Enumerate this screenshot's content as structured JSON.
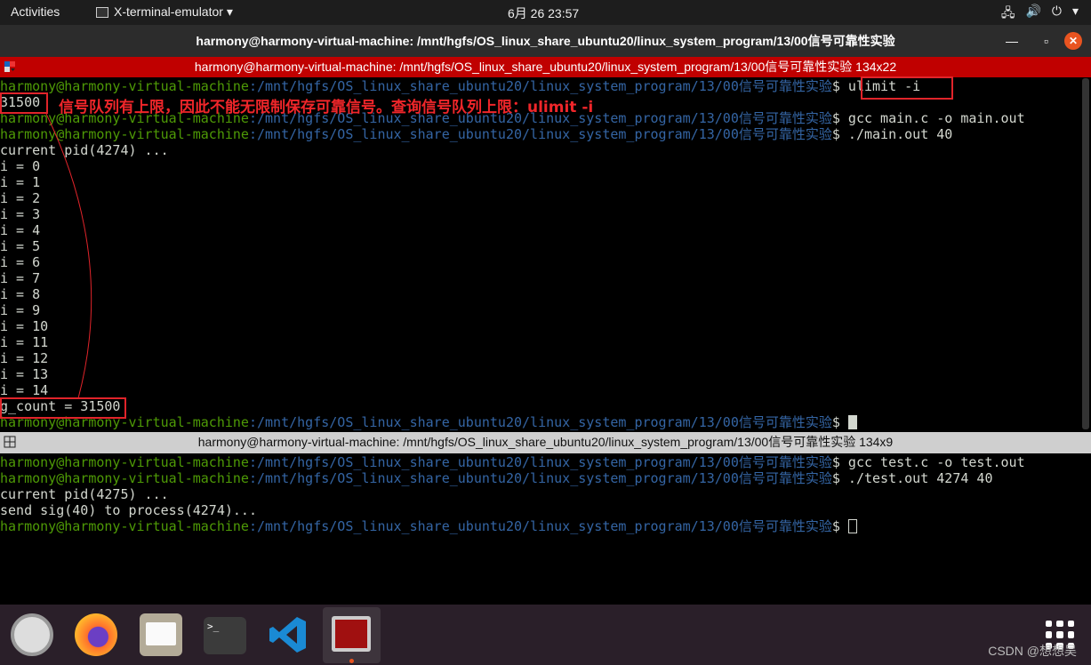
{
  "topbar": {
    "activities": "Activities",
    "app_name": "X-terminal-emulator ▾",
    "clock": "6月 26  23:57",
    "tray": [
      "network-icon",
      "volume-icon",
      "power-icon"
    ],
    "tray_glyphs": [
      "🖧",
      "🔊",
      "⏻",
      "▾"
    ]
  },
  "window": {
    "title": "harmony@harmony-virtual-machine: /mnt/hgfs/OS_linux_share_ubuntu20/linux_system_program/13/00信号可靠性实验",
    "minimize": "—",
    "maximize": "▫",
    "close": "✕"
  },
  "pane1": {
    "title": "harmony@harmony-virtual-machine: /mnt/hgfs/OS_linux_share_ubuntu20/linux_system_program/13/00信号可靠性实验 134x22",
    "lines": [
      {
        "user": "harmony@harmony-virtual-machine",
        "path": ":/mnt/hgfs/OS_linux_share_ubuntu20/linux_system_program/13/00信号可靠性实验",
        "cmd": "$ ulimit -i"
      },
      {
        "text": "31500"
      },
      {
        "user": "harmony@harmony-virtual-machine",
        "path": ":/mnt/hgfs/OS_linux_share_ubuntu20/linux_system_program/13/00信号可靠性实验",
        "cmd": "$ gcc main.c -o main.out"
      },
      {
        "user": "harmony@harmony-virtual-machine",
        "path": ":/mnt/hgfs/OS_linux_share_ubuntu20/linux_system_program/13/00信号可靠性实验",
        "cmd": "$ ./main.out 40"
      },
      {
        "text": "current pid(4274) ..."
      },
      {
        "text": "i = 0"
      },
      {
        "text": "i = 1"
      },
      {
        "text": "i = 2"
      },
      {
        "text": "i = 3"
      },
      {
        "text": "i = 4"
      },
      {
        "text": "i = 5"
      },
      {
        "text": "i = 6"
      },
      {
        "text": "i = 7"
      },
      {
        "text": "i = 8"
      },
      {
        "text": "i = 9"
      },
      {
        "text": "i = 10"
      },
      {
        "text": "i = 11"
      },
      {
        "text": "i = 12"
      },
      {
        "text": "i = 13"
      },
      {
        "text": "i = 14"
      },
      {
        "text": "g_count = 31500"
      },
      {
        "user": "harmony@harmony-virtual-machine",
        "path": ":/mnt/hgfs/OS_linux_share_ubuntu20/linux_system_program/13/00信号可靠性实验",
        "cmd": "$ ",
        "cursor": "solid"
      }
    ]
  },
  "annotation": "信号队列有上限，因此不能无限制保存可靠信号。查询信号队列上限：ulimit  -i",
  "pane2": {
    "title": "harmony@harmony-virtual-machine: /mnt/hgfs/OS_linux_share_ubuntu20/linux_system_program/13/00信号可靠性实验 134x9",
    "lines": [
      {
        "user": "harmony@harmony-virtual-machine",
        "path": ":/mnt/hgfs/OS_linux_share_ubuntu20/linux_system_program/13/00信号可靠性实验",
        "cmd": "$ gcc test.c -o test.out"
      },
      {
        "user": "harmony@harmony-virtual-machine",
        "path": ":/mnt/hgfs/OS_linux_share_ubuntu20/linux_system_program/13/00信号可靠性实验",
        "cmd": "$ ./test.out 4274 40"
      },
      {
        "text": "current pid(4275) ..."
      },
      {
        "text": "send sig(40) to process(4274)..."
      },
      {
        "user": "harmony@harmony-virtual-machine",
        "path": ":/mnt/hgfs/OS_linux_share_ubuntu20/linux_system_program/13/00信号可靠性实验",
        "cmd": "$ ",
        "cursor": "hollow"
      }
    ]
  },
  "dock": {
    "apps": [
      "settings",
      "firefox",
      "files",
      "terminal",
      "vscode",
      "x-terminal-emulator"
    ],
    "show_apps": "show-applications"
  },
  "watermark": "CSDN @想想吴",
  "colors": {
    "user": "#4e9a06",
    "path": "#3465a4",
    "pane_bar": "#c00000",
    "annotation": "#e0242a"
  }
}
